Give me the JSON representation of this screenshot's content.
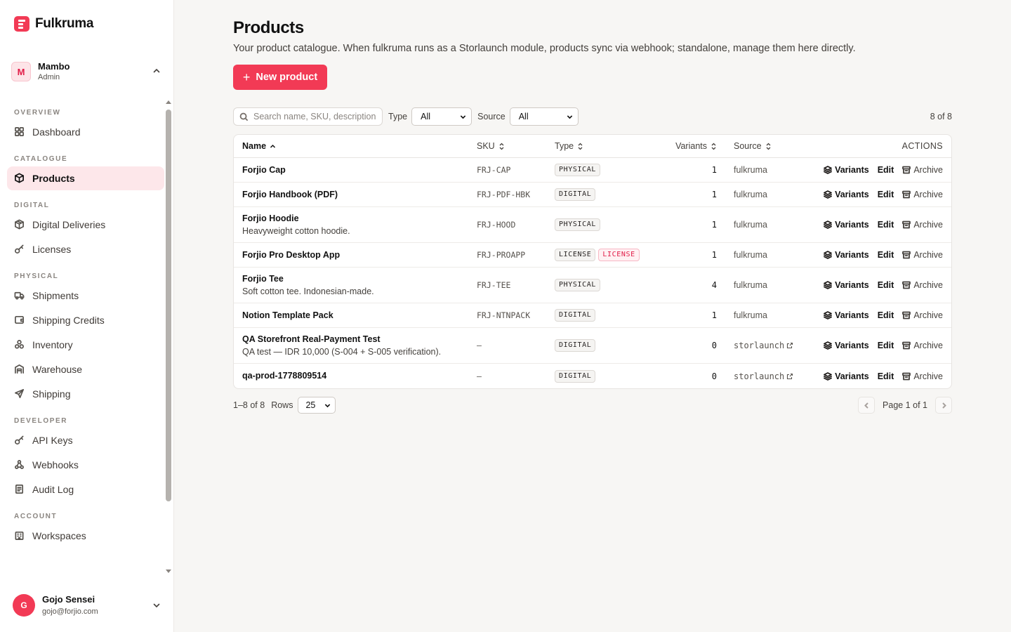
{
  "brand": {
    "name": "Fulkruma",
    "logo_color": "#f23a55"
  },
  "workspace": {
    "avatar": "M",
    "name": "Mambo",
    "role": "Admin"
  },
  "nav": {
    "sections": [
      {
        "label": "OVERVIEW",
        "items": [
          {
            "label": "Dashboard",
            "icon": "dashboard-icon"
          }
        ]
      },
      {
        "label": "CATALOGUE",
        "items": [
          {
            "label": "Products",
            "icon": "box-icon",
            "active": true
          }
        ]
      },
      {
        "label": "DIGITAL",
        "items": [
          {
            "label": "Digital Deliveries",
            "icon": "package-icon"
          },
          {
            "label": "Licenses",
            "icon": "key-icon"
          }
        ]
      },
      {
        "label": "PHYSICAL",
        "items": [
          {
            "label": "Shipments",
            "icon": "truck-icon"
          },
          {
            "label": "Shipping Credits",
            "icon": "wallet-icon"
          },
          {
            "label": "Inventory",
            "icon": "boxes-icon"
          },
          {
            "label": "Warehouse",
            "icon": "warehouse-icon"
          },
          {
            "label": "Shipping",
            "icon": "send-icon"
          }
        ]
      },
      {
        "label": "DEVELOPER",
        "items": [
          {
            "label": "API Keys",
            "icon": "key-icon"
          },
          {
            "label": "Webhooks",
            "icon": "webhook-icon"
          },
          {
            "label": "Audit Log",
            "icon": "log-icon"
          }
        ]
      },
      {
        "label": "ACCOUNT",
        "items": [
          {
            "label": "Workspaces",
            "icon": "building-icon"
          }
        ]
      }
    ]
  },
  "user": {
    "avatar": "G",
    "name": "Gojo Sensei",
    "email": "gojo@forjio.com"
  },
  "page": {
    "title": "Products",
    "subtitle": "Your product catalogue. When fulkruma runs as a Storlaunch module, products sync via webhook; standalone, manage them here directly.",
    "new_button": "New product"
  },
  "filters": {
    "search_placeholder": "Search name, SKU, description",
    "type_label": "Type",
    "type_value": "All",
    "source_label": "Source",
    "source_value": "All",
    "count": "8 of 8"
  },
  "table": {
    "columns": {
      "name": "Name",
      "sku": "SKU",
      "type": "Type",
      "variants": "Variants",
      "source": "Source",
      "actions": "ACTIONS"
    },
    "action_labels": {
      "variants": "Variants",
      "edit": "Edit",
      "archive": "Archive"
    },
    "rows": [
      {
        "name": "Forjio Cap",
        "desc": "",
        "sku": "FRJ-CAP",
        "types": [
          "PHYSICAL"
        ],
        "variants": "1",
        "source": "fulkruma",
        "external": false
      },
      {
        "name": "Forjio Handbook (PDF)",
        "desc": "",
        "sku": "FRJ-PDF-HBK",
        "types": [
          "DIGITAL"
        ],
        "variants": "1",
        "source": "fulkruma",
        "external": false
      },
      {
        "name": "Forjio Hoodie",
        "desc": "Heavyweight cotton hoodie.",
        "sku": "FRJ-HOOD",
        "types": [
          "PHYSICAL"
        ],
        "variants": "1",
        "source": "fulkruma",
        "external": false
      },
      {
        "name": "Forjio Pro Desktop App",
        "desc": "",
        "sku": "FRJ-PROAPP",
        "types": [
          "LICENSE",
          "LICENSE"
        ],
        "variants": "1",
        "source": "fulkruma",
        "external": false
      },
      {
        "name": "Forjio Tee",
        "desc": "Soft cotton tee. Indonesian-made.",
        "sku": "FRJ-TEE",
        "types": [
          "PHYSICAL"
        ],
        "variants": "4",
        "source": "fulkruma",
        "external": false
      },
      {
        "name": "Notion Template Pack",
        "desc": "",
        "sku": "FRJ-NTNPACK",
        "types": [
          "DIGITAL"
        ],
        "variants": "1",
        "source": "fulkruma",
        "external": false
      },
      {
        "name": "QA Storefront Real-Payment Test",
        "desc": "QA test — IDR 10,000 (S-004 + S-005 verification).",
        "sku": "–",
        "types": [
          "DIGITAL"
        ],
        "variants": "0",
        "source": "storlaunch",
        "external": true
      },
      {
        "name": "qa-prod-1778809514",
        "desc": "",
        "sku": "–",
        "types": [
          "DIGITAL"
        ],
        "variants": "0",
        "source": "storlaunch",
        "external": true
      }
    ]
  },
  "pagination": {
    "range": "1–8 of 8",
    "rows_label": "Rows",
    "rows_value": "25",
    "page": "Page 1 of 1"
  }
}
